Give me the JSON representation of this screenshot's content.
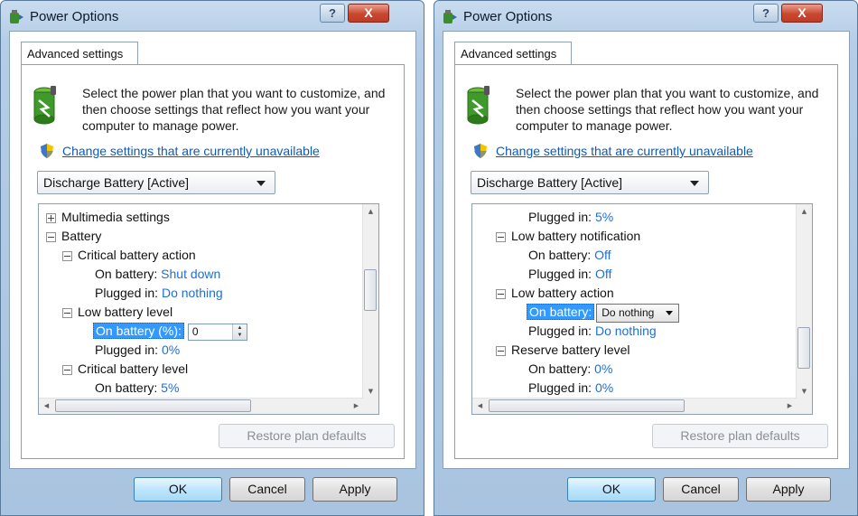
{
  "windows": [
    {
      "title": "Power Options",
      "help_label": "?",
      "close_label": "X",
      "tab": "Advanced settings",
      "description": "Select the power plan that you want to customize, and then choose settings that reflect how you want your computer to manage power.",
      "change_link": "Change settings that are currently unavailable",
      "plan": "Discharge Battery [Active]",
      "tree": {
        "multimedia": "Multimedia settings",
        "battery": "Battery",
        "critical_action": "Critical battery action",
        "on_battery_label": "On battery:",
        "shut_down": "Shut down",
        "plugged_in_label": "Plugged in:",
        "do_nothing": "Do nothing",
        "low_level": "Low battery level",
        "on_battery_pct_label": "On battery (%):",
        "spin_value": "0",
        "plugged_pct": "0%",
        "critical_level": "Critical battery level",
        "on_battery_cut": "On battery:",
        "crit_value": "5%"
      },
      "restore": "Restore plan defaults",
      "ok": "OK",
      "cancel": "Cancel",
      "apply": "Apply"
    },
    {
      "title": "Power Options",
      "help_label": "?",
      "close_label": "X",
      "tab": "Advanced settings",
      "description": "Select the power plan that you want to customize, and then choose settings that reflect how you want your computer to manage power.",
      "change_link": "Change settings that are currently unavailable",
      "plan": "Discharge Battery [Active]",
      "tree": {
        "plugged_in_label": "Plugged in:",
        "plugged_5": "5%",
        "low_notification": "Low battery notification",
        "on_battery_label": "On battery:",
        "off": "Off",
        "low_action": "Low battery action",
        "combo_value": "Do nothing",
        "do_nothing": "Do nothing",
        "reserve_level": "Reserve battery level",
        "pct_0": "0%"
      },
      "restore": "Restore plan defaults",
      "ok": "OK",
      "cancel": "Cancel",
      "apply": "Apply"
    }
  ]
}
